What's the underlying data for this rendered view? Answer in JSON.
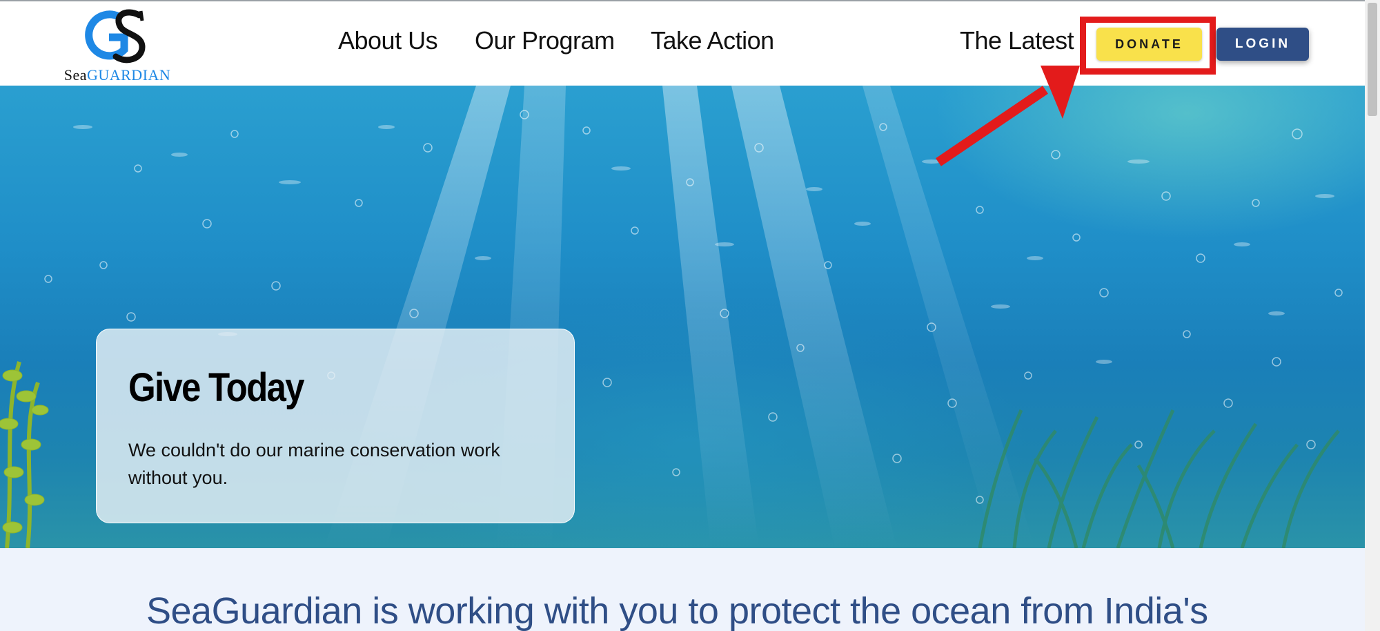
{
  "header": {
    "logo": {
      "text_first": "Sea",
      "text_second": "Guardian",
      "monogram": "GS"
    },
    "nav": [
      {
        "label": "About Us"
      },
      {
        "label": "Our Program"
      },
      {
        "label": "Take Action"
      },
      {
        "label": "The Latest"
      }
    ],
    "donate_label": "DONATE",
    "login_label": "LOGIN"
  },
  "hero": {
    "card_title": "Give Today",
    "card_text": "We couldn't do our marine conservation work without you."
  },
  "section": {
    "heading": "SeaGuardian is working with you to protect the ocean from India's"
  },
  "colors": {
    "donate": "#f9e14b",
    "login": "#2f4e86",
    "highlight": "#e31b1b",
    "heading": "#2f4e86"
  },
  "icons": [
    "seaguardian-logo-icon",
    "red-arrow-annotation-icon"
  ]
}
